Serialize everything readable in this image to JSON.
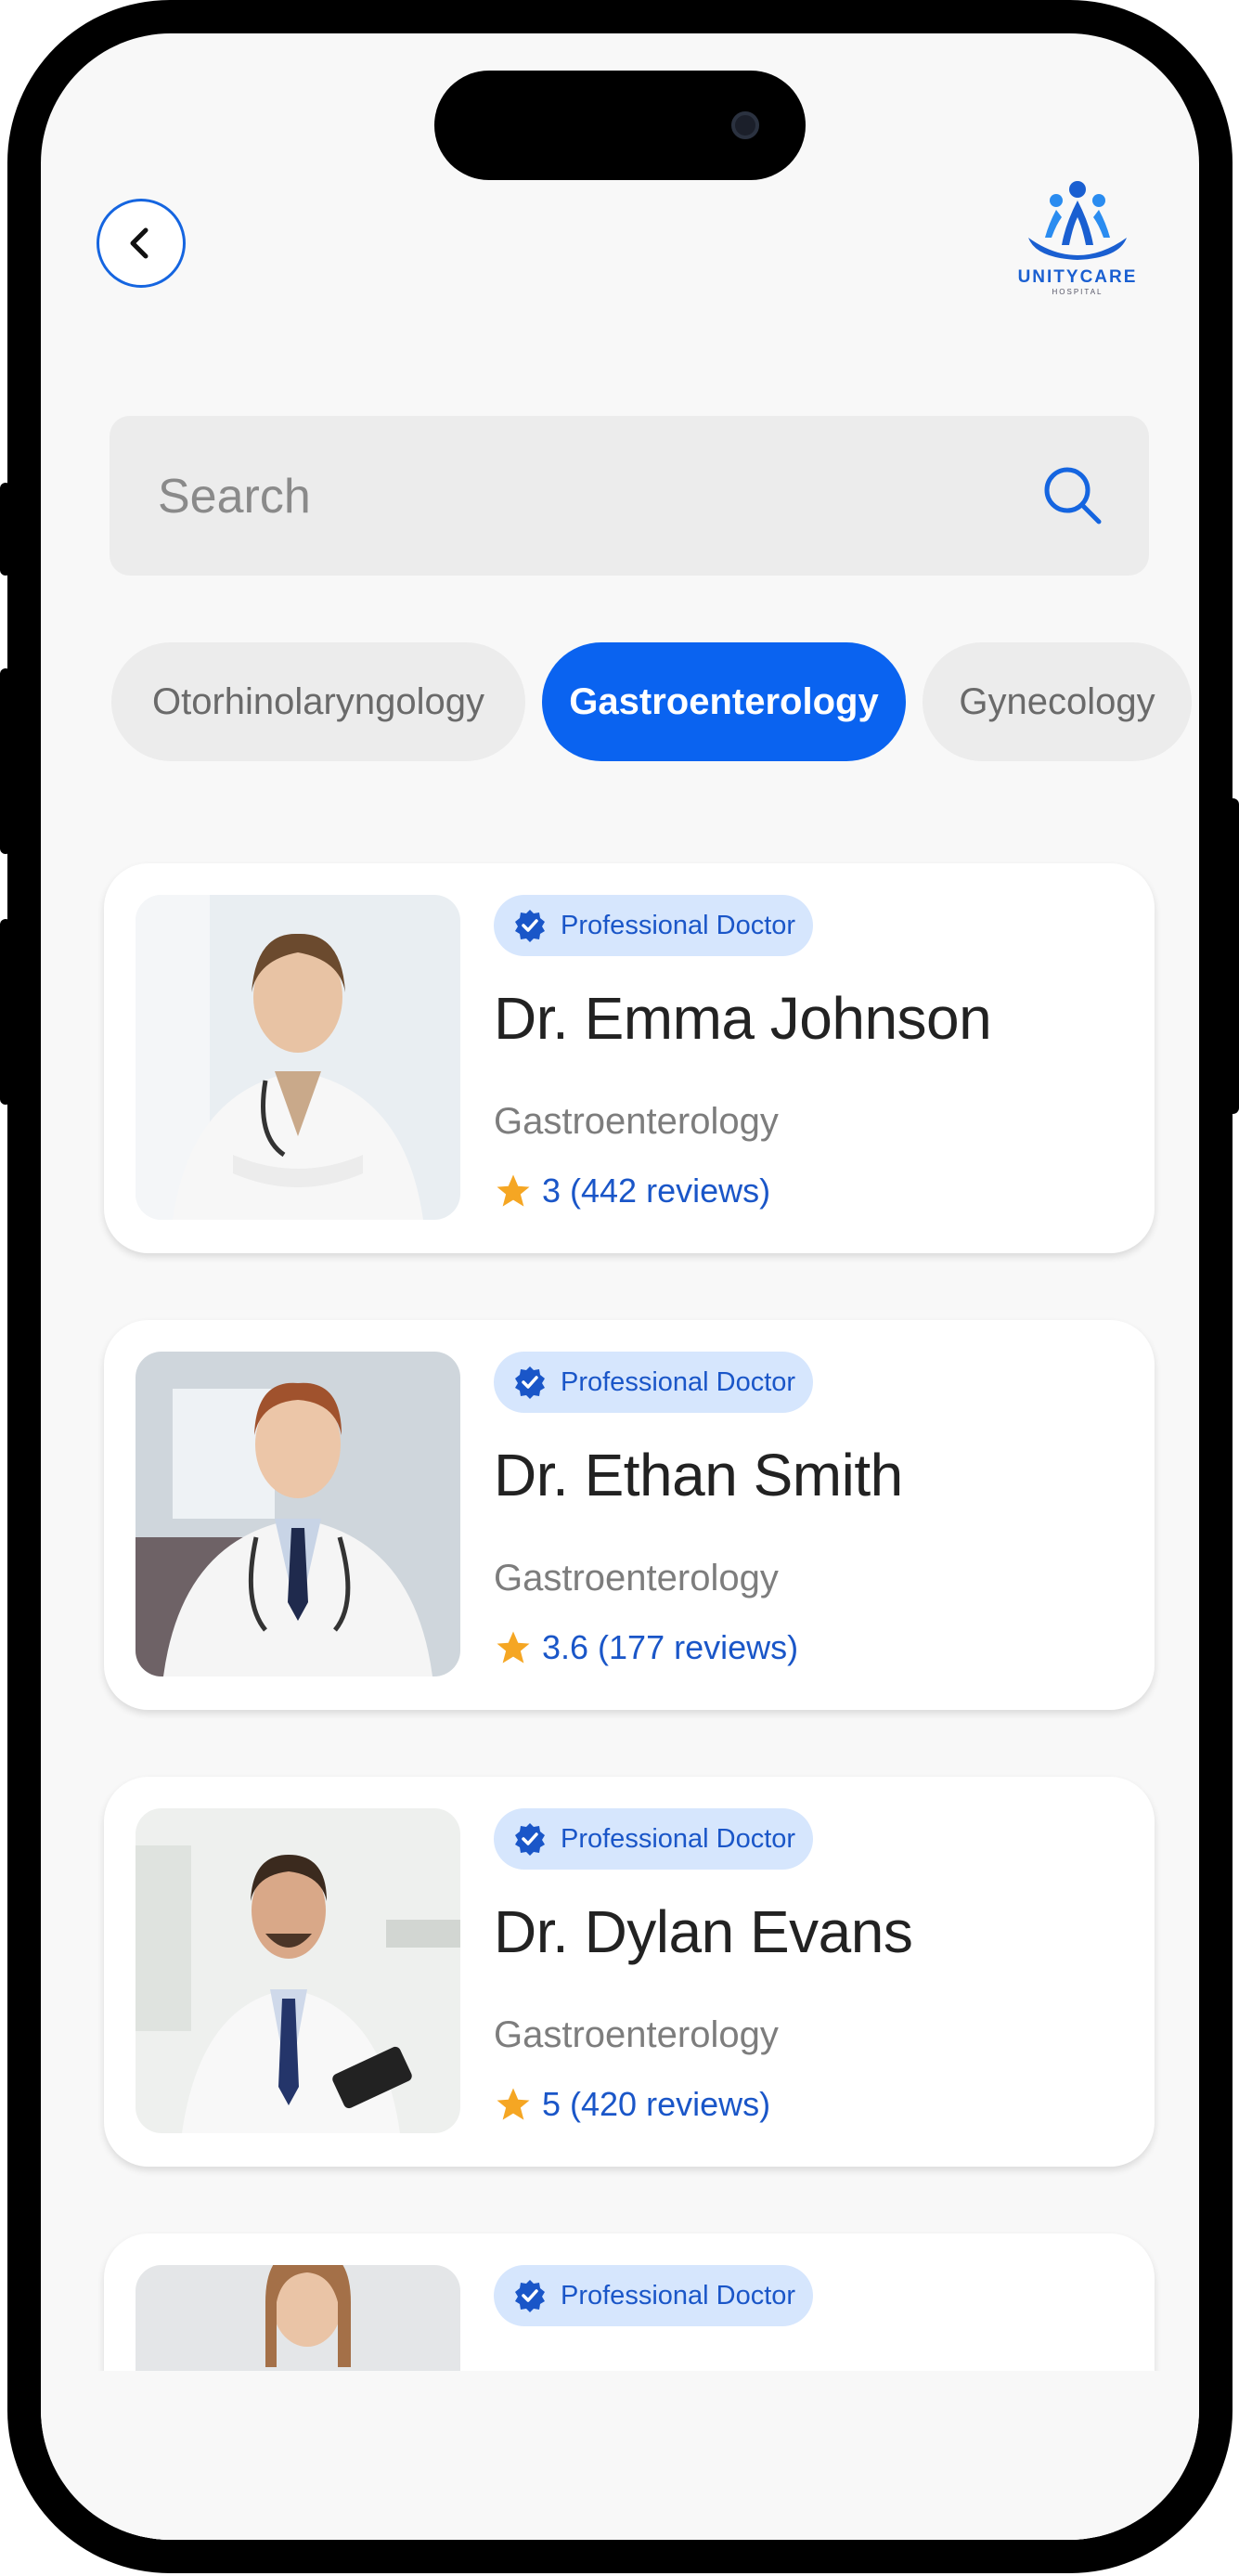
{
  "header": {
    "back_label": "Back",
    "logo_text": "UNITYCARE",
    "logo_subtext": "HOSPITAL"
  },
  "search": {
    "placeholder": "Search",
    "value": ""
  },
  "categories": [
    {
      "label": "Otorhinolaryngology",
      "active": false
    },
    {
      "label": "Gastroenterology",
      "active": true
    },
    {
      "label": "Gynecology",
      "active": false
    }
  ],
  "doctors": [
    {
      "badge": "Professional Doctor",
      "name": "Dr. Emma Johnson",
      "specialty": "Gastroenterology",
      "rating": "3 (442 reviews)"
    },
    {
      "badge": "Professional Doctor",
      "name": "Dr. Ethan Smith",
      "specialty": "Gastroenterology",
      "rating": "3.6 (177 reviews)"
    },
    {
      "badge": "Professional Doctor",
      "name": "Dr. Dylan Evans",
      "specialty": "Gastroenterology",
      "rating": "5 (420 reviews)"
    },
    {
      "badge": "Professional Doctor",
      "name": "",
      "specialty": "",
      "rating": ""
    }
  ],
  "colors": {
    "accent": "#0a63f0",
    "badge_bg": "#d6e6fd",
    "star": "#f5a623"
  },
  "icons": {
    "back": "chevron-left-icon",
    "search": "search-icon",
    "badge": "verified-check-icon",
    "rating": "star-icon"
  }
}
